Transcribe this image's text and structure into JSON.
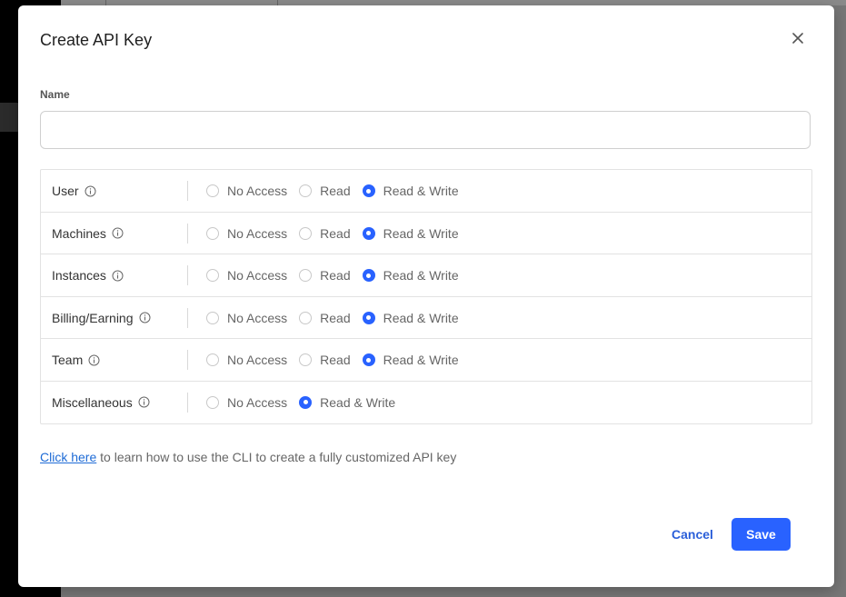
{
  "modal": {
    "title": "Create API Key",
    "close_icon": "close-icon"
  },
  "name_field": {
    "label": "Name",
    "value": "",
    "placeholder": ""
  },
  "permissions": [
    {
      "label": "User",
      "options": [
        "No Access",
        "Read",
        "Read & Write"
      ],
      "selected": "Read & Write"
    },
    {
      "label": "Machines",
      "options": [
        "No Access",
        "Read",
        "Read & Write"
      ],
      "selected": "Read & Write"
    },
    {
      "label": "Instances",
      "options": [
        "No Access",
        "Read",
        "Read & Write"
      ],
      "selected": "Read & Write"
    },
    {
      "label": "Billing/Earning",
      "options": [
        "No Access",
        "Read",
        "Read & Write"
      ],
      "selected": "Read & Write"
    },
    {
      "label": "Team",
      "options": [
        "No Access",
        "Read",
        "Read & Write"
      ],
      "selected": "Read & Write"
    },
    {
      "label": "Miscellaneous",
      "options": [
        "No Access",
        "Read & Write"
      ],
      "selected": "Read & Write"
    }
  ],
  "help": {
    "link_text": "Click here",
    "text": " to learn how to use the CLI to create a fully customized API key"
  },
  "footer": {
    "cancel_label": "Cancel",
    "save_label": "Save"
  },
  "colors": {
    "accent": "#2962ff",
    "link": "#1e6bd6"
  }
}
